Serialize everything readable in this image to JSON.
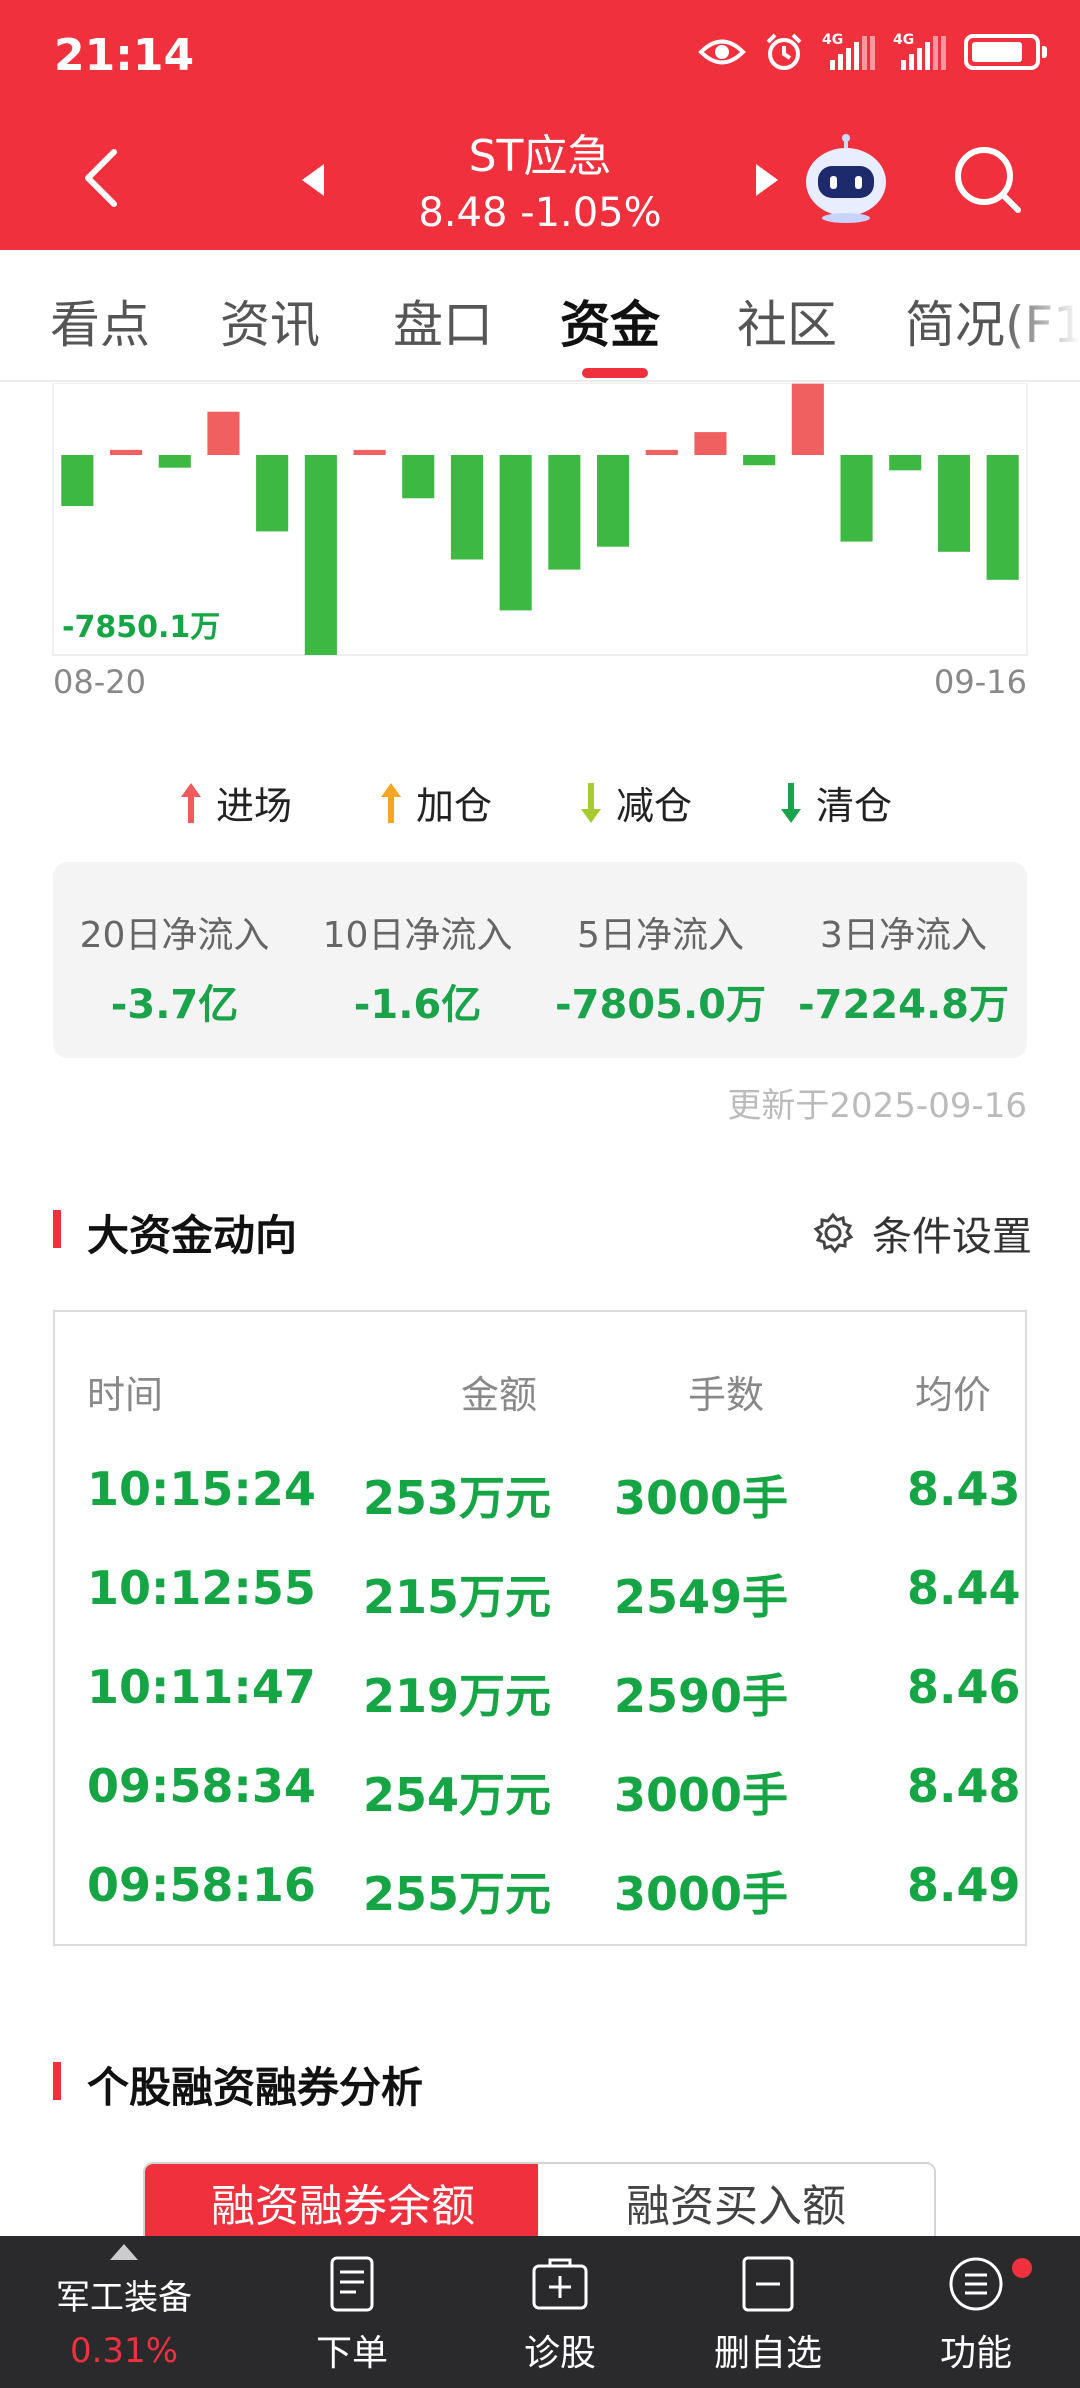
{
  "status_bar": {
    "time": "21:14",
    "network_1": "4G",
    "network_2": "4G",
    "icons": [
      "eye-icon",
      "alarm-icon",
      "signal-icon",
      "signal-icon",
      "battery-icon"
    ]
  },
  "header": {
    "stock_name": "ST应急",
    "price_change": "8.48  -1.05%",
    "icons": [
      "back-icon",
      "prev-stock-icon",
      "next-stock-icon",
      "robot-assistant-icon",
      "search-icon"
    ]
  },
  "tabs": [
    "看点",
    "资讯",
    "盘口",
    "资金",
    "社区",
    "简况(F1"
  ],
  "active_tab": "资金",
  "chart_data": {
    "type": "bar",
    "title": "",
    "min_label": "-7850.1万",
    "start_date": "08-20",
    "end_date": "09-16",
    "values": [
      -2000,
      200,
      -500,
      1700,
      -3000,
      -7850.1,
      200,
      -1700,
      -4100,
      -6100,
      -4500,
      -3600,
      200,
      900,
      -400,
      2800,
      -3400,
      -600,
      -3800,
      -4900
    ]
  },
  "legend": [
    {
      "label": "进场",
      "color": "#f05a5a",
      "direction": "up"
    },
    {
      "label": "加仓",
      "color": "#f5a623",
      "direction": "up"
    },
    {
      "label": "减仓",
      "color": "#a6cc2f",
      "direction": "down"
    },
    {
      "label": "清仓",
      "color": "#1aa34a",
      "direction": "down"
    }
  ],
  "net_inflow": [
    {
      "label": "20日净流入",
      "value": "-3.7亿"
    },
    {
      "label": "10日净流入",
      "value": "-1.6亿"
    },
    {
      "label": "5日净流入",
      "value": "-7805.0万"
    },
    {
      "label": "3日净流入",
      "value": "-7224.8万"
    }
  ],
  "updated": "更新于2025-09-16",
  "big_money": {
    "title": "大资金动向",
    "settings_label": "条件设置",
    "headers": [
      "时间",
      "金额",
      "手数",
      "均价"
    ],
    "rows": [
      [
        "10:15:24",
        "253万元",
        "3000手",
        "8.43"
      ],
      [
        "10:12:55",
        "215万元",
        "2549手",
        "8.44"
      ],
      [
        "10:11:47",
        "219万元",
        "2590手",
        "8.46"
      ],
      [
        "09:58:34",
        "254万元",
        "3000手",
        "8.48"
      ],
      [
        "09:58:16",
        "255万元",
        "3000手",
        "8.49"
      ]
    ]
  },
  "margin": {
    "title": "个股融资融券分析",
    "tab_active": "融资融券余额",
    "tab_inactive": "融资买入额"
  },
  "bottom_nav": {
    "sector_name": "军工装备",
    "sector_change": "0.31%",
    "items": [
      "下单",
      "诊股",
      "删自选",
      "功能"
    ]
  },
  "colors": {
    "brand_red": "#f0313d",
    "green": "#16a544",
    "bar_red": "#f06060",
    "bar_green": "#3cb843"
  }
}
